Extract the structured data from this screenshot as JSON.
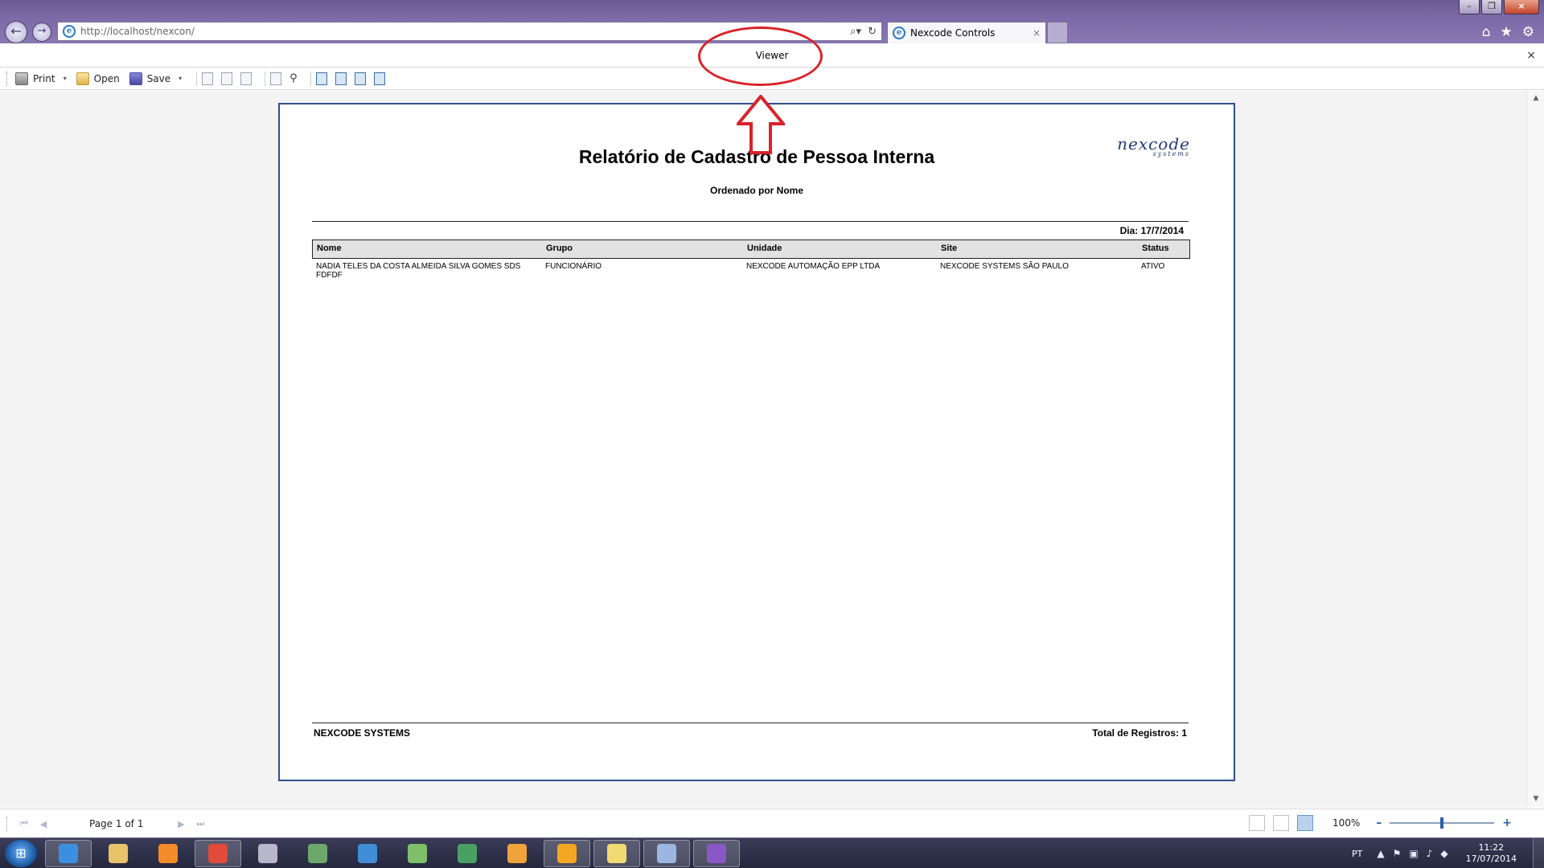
{
  "browser": {
    "url_host": "http://localhost/nexcon/",
    "tab_title": "Nexcode Controls",
    "tab_close": "×",
    "back": "←",
    "forward": "→",
    "addr_search": "⌕▾",
    "addr_refresh": "↻",
    "home": "⌂",
    "favorites": "★",
    "tools": "⚙",
    "minimize": "–",
    "restore": "❐",
    "close": "×"
  },
  "viewer": {
    "title": "Viewer",
    "close": "×"
  },
  "toolbar": {
    "print_label": "Print",
    "open_label": "Open",
    "save_label": "Save",
    "caret": "▾",
    "find_glyph": "⚲"
  },
  "report": {
    "title": "Relatório de Cadastro de Pessoa Interna",
    "subtitle": "Ordenado por Nome",
    "logo_main": "nexcode",
    "logo_sub": "systems",
    "date": "Dia: 17/7/2014",
    "columns": [
      "Nome",
      "Grupo",
      "Unidade",
      "Site",
      "Status"
    ],
    "rows": [
      {
        "nome": "NADIA TELES DA COSTA ALMEIDA SILVA GOMES SDS FDFDF",
        "grupo": "FUNCIONÁRIO",
        "unidade": "NEXCODE AUTOMAÇÃO EPP LTDA",
        "site": "NEXCODE SYSTEMS SÃO PAULO",
        "status": "ATIVO"
      }
    ],
    "footer_left": "NEXCODE SYSTEMS",
    "footer_right": "Total de Registros: 1"
  },
  "pager": {
    "first": "⏮",
    "prev": "◀",
    "page_text": "Page 1 of 1",
    "next": "▶",
    "last": "⏭",
    "zoom": "100%",
    "zoom_minus": "–",
    "zoom_plus": "+",
    "zoom_level": 0.5
  },
  "taskbar": {
    "start": "⊞",
    "language": "PT",
    "time": "11:22",
    "date": "17/07/2014",
    "apps": [
      {
        "name": "internet-explorer",
        "color": "#3c8fe0",
        "active": true
      },
      {
        "name": "windows-explorer",
        "color": "#e8c36a",
        "active": false
      },
      {
        "name": "media-player",
        "color": "#f28b2a",
        "active": false
      },
      {
        "name": "chrome",
        "color": "#e04b3a",
        "active": true
      },
      {
        "name": "tools",
        "color": "#b7b7c9",
        "active": false
      },
      {
        "name": "database",
        "color": "#6ca86a",
        "active": false
      },
      {
        "name": "outlook-ish",
        "color": "#3f8ed6",
        "active": false
      },
      {
        "name": "network",
        "color": "#7fbf6a",
        "active": false
      },
      {
        "name": "terminal",
        "color": "#4aa063",
        "active": false
      },
      {
        "name": "transfer",
        "color": "#f1a33b",
        "active": false
      },
      {
        "name": "outlook",
        "color": "#f5a623",
        "active": true
      },
      {
        "name": "folder",
        "color": "#f2da72",
        "active": true
      },
      {
        "name": "paint",
        "color": "#9bb7e0",
        "active": true
      },
      {
        "name": "visual-studio",
        "color": "#8a57c7",
        "active": true
      }
    ]
  },
  "annotation": {
    "color": "#d8232a"
  }
}
